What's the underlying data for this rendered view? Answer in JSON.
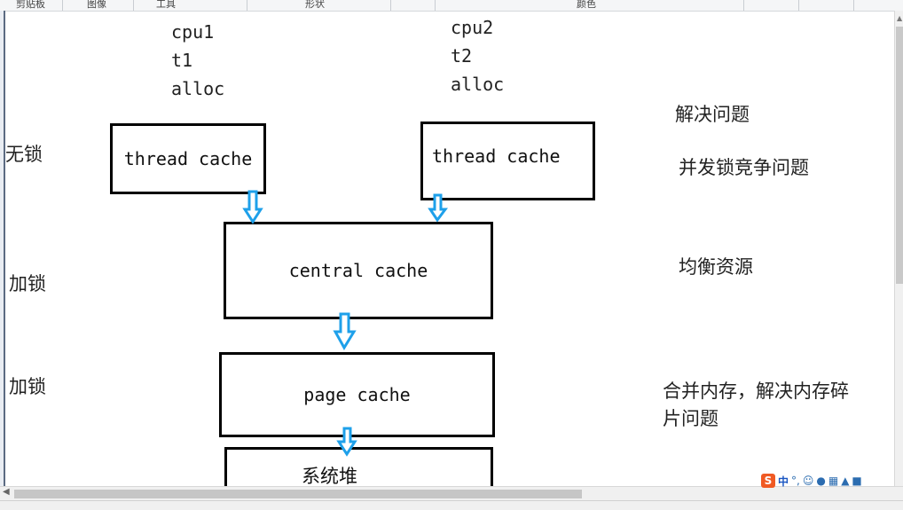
{
  "ribbon": {
    "groups": [
      "剪贴板",
      "图像",
      "工具",
      "形状",
      "颜色"
    ]
  },
  "labels": {
    "cpu1": "cpu1",
    "t1": "t1",
    "alloc1": "alloc",
    "cpu2": "cpu2",
    "t2": "t2",
    "alloc2": "alloc"
  },
  "left_notes": {
    "lock_free": "无锁",
    "lock1": "加锁",
    "lock2": "加锁"
  },
  "boxes": {
    "thread_cache_1": "thread cache",
    "thread_cache_2": "thread cache",
    "central_cache": "central cache",
    "page_cache": "page cache",
    "system_heap": "系统堆"
  },
  "right_notes": {
    "title": "解决问题",
    "concurrency": "并发锁竞争问题",
    "balance": "均衡资源",
    "merge_line1": "合并内存，解决内存碎",
    "merge_line2": "片问题"
  },
  "ime": {
    "logo": "S",
    "mode": "中",
    "punct": "°,",
    "emoji_icon": "smiley-icon",
    "voice_icon": "microphone-icon",
    "keyboard_icon": "keyboard-icon",
    "toolbox_icon": "toolbox-icon",
    "shirt_icon": "skin-icon"
  },
  "colors": {
    "arrow": "#1ea0ea",
    "box_border": "#000000",
    "ime_logo": "#f05a24"
  }
}
